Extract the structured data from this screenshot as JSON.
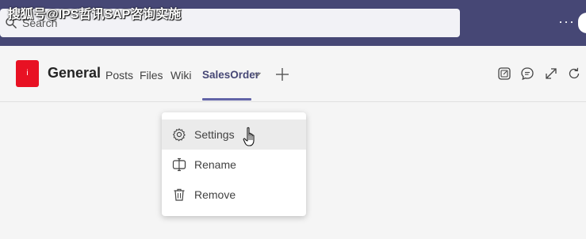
{
  "watermark": "搜狐号@IPS哲讯SAP咨询实施",
  "search": {
    "placeholder": "Search"
  },
  "topbar": {
    "more_label": "···",
    "accent_color": "#464775"
  },
  "team": {
    "avatar_letter": "i",
    "avatar_color": "#e81123"
  },
  "channel": {
    "name": "General",
    "tabs": [
      {
        "label": "Posts"
      },
      {
        "label": "Files"
      },
      {
        "label": "Wiki"
      },
      {
        "label": "SalesOrder",
        "active": true
      }
    ],
    "add_tab_icon": "plus-icon"
  },
  "header_actions": [
    "popout-icon",
    "chat-icon",
    "expand-icon",
    "refresh-icon"
  ],
  "tab_menu": {
    "items": [
      {
        "label": "Settings",
        "icon": "gear-icon",
        "hovered": true
      },
      {
        "label": "Rename",
        "icon": "rename-icon"
      },
      {
        "label": "Remove",
        "icon": "trash-icon"
      }
    ]
  }
}
